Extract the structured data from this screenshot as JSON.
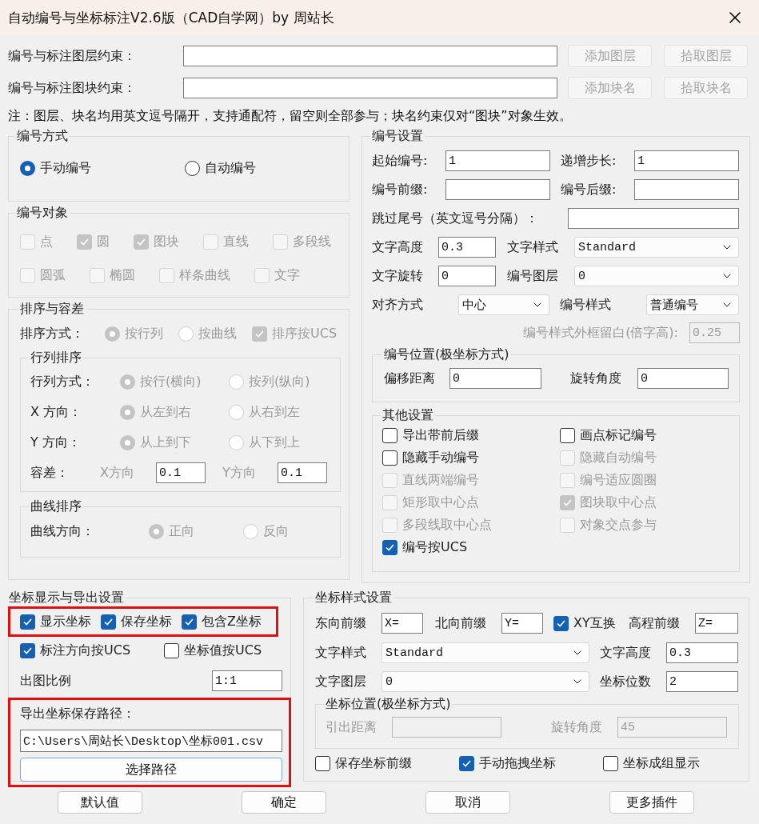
{
  "window": {
    "title": "自动编号与坐标标注V2.6版（CAD自学网）by 周站长"
  },
  "constraints": [
    {
      "label": "编号与标注图层约束：",
      "buttons": [
        {
          "label": "添加图层",
          "disabled": true
        },
        {
          "label": "拾取图层",
          "disabled": true
        }
      ]
    },
    {
      "label": "编号与标注图块约束：",
      "buttons": [
        {
          "label": "添加块名",
          "disabled": true
        },
        {
          "label": "拾取块名",
          "disabled": true
        }
      ]
    }
  ],
  "note": "注：图层、块名均用英文逗号隔开，支持通配符，留空则全部参与；块名约束仅对“图块”对象生效。",
  "numbering_mode": {
    "title": "编号方式",
    "options": [
      {
        "label": "手动编号",
        "selected": true
      },
      {
        "label": "自动编号",
        "selected": false
      }
    ]
  },
  "numbering_objects": {
    "title": "编号对象",
    "items": [
      {
        "label": "点",
        "checked": false,
        "disabled": true
      },
      {
        "label": "圆",
        "checked": true,
        "disabled": true
      },
      {
        "label": "图块",
        "checked": true,
        "disabled": true
      },
      {
        "label": "直线",
        "checked": false,
        "disabled": true
      },
      {
        "label": "多段线",
        "checked": false,
        "disabled": true
      },
      {
        "label": "圆弧",
        "checked": false,
        "disabled": true
      },
      {
        "label": "椭圆",
        "checked": false,
        "disabled": true
      },
      {
        "label": "样条曲线",
        "checked": false,
        "disabled": true
      },
      {
        "label": "文字",
        "checked": false,
        "disabled": true
      }
    ]
  },
  "sorting": {
    "title": "排序与容差",
    "method_label": "排序方式：",
    "methods": [
      {
        "label": "按行列",
        "selected": true,
        "disabled": true
      },
      {
        "label": "按曲线",
        "selected": false,
        "disabled": true
      }
    ],
    "ucs": {
      "label": "排序按UCS",
      "checked": true,
      "disabled": true
    },
    "row_col": {
      "title": "行列排序",
      "rows": [
        {
          "label": "行列方式：",
          "options": [
            {
              "label": "按行(横向)",
              "selected": true,
              "disabled": true
            },
            {
              "label": "按列(纵向)",
              "selected": false,
              "disabled": true
            }
          ]
        },
        {
          "label": "X 方向：",
          "options": [
            {
              "label": "从左到右",
              "selected": true,
              "disabled": true
            },
            {
              "label": "从右到左",
              "selected": false,
              "disabled": true
            }
          ]
        },
        {
          "label": "Y 方向：",
          "options": [
            {
              "label": "从上到下",
              "selected": true,
              "disabled": true
            },
            {
              "label": "从下到上",
              "selected": false,
              "disabled": true
            }
          ]
        }
      ],
      "tolerance": {
        "label": "容差：",
        "x_label": "X方向",
        "x_value": "0.1",
        "y_label": "Y方向",
        "y_value": "0.1",
        "disabled": true
      }
    },
    "curve": {
      "title": "曲线排序",
      "label": "曲线方向：",
      "options": [
        {
          "label": "正向",
          "selected": true,
          "disabled": true
        },
        {
          "label": "反向",
          "selected": false,
          "disabled": true
        }
      ]
    }
  },
  "numbering_settings": {
    "title": "编号设置",
    "start": {
      "label": "起始编号:",
      "value": "1"
    },
    "step": {
      "label": "递增步长:",
      "value": "1"
    },
    "prefix": {
      "label": "编号前缀:"
    },
    "suffix": {
      "label": "编号后缀:"
    },
    "skip": {
      "label": "跳过尾号（英文逗号分隔）："
    },
    "text_height": {
      "label": "文字高度",
      "value": "0.3"
    },
    "text_style": {
      "label": "文字样式",
      "value": "Standard"
    },
    "text_rotation": {
      "label": "文字旋转",
      "value": "0"
    },
    "layer": {
      "label": "编号图层",
      "value": "0"
    },
    "align": {
      "label": "对齐方式",
      "value": "中心"
    },
    "number_style": {
      "label": "编号样式",
      "value": "普通编号"
    },
    "frame_margin": {
      "label": "编号样式外框留白(倍字高):",
      "value": "0.25",
      "disabled": true
    },
    "position": {
      "title": "编号位置(极坐标方式)",
      "offset": {
        "label": "偏移距离",
        "value": "0"
      },
      "angle": {
        "label": "旋转角度",
        "value": "0"
      }
    },
    "other": {
      "title": "其他设置",
      "options": [
        {
          "label": "导出带前后缀",
          "checked": false,
          "disabled": false
        },
        {
          "label": "画点标记编号",
          "checked": false,
          "disabled": false
        },
        {
          "label": "隐藏手动编号",
          "checked": false,
          "disabled": false
        },
        {
          "label": "隐藏自动编号",
          "checked": false,
          "disabled": true
        },
        {
          "label": "直线两端编号",
          "checked": false,
          "disabled": true
        },
        {
          "label": "编号适应圆圈",
          "checked": false,
          "disabled": true
        },
        {
          "label": "矩形取中心点",
          "checked": false,
          "disabled": true
        },
        {
          "label": "图块取中心点",
          "checked": true,
          "disabled": true
        },
        {
          "label": "多段线取中心点",
          "checked": false,
          "disabled": true
        },
        {
          "label": "对象交点参与",
          "checked": false,
          "disabled": true
        },
        {
          "label": "编号按UCS",
          "checked": true,
          "disabled": false
        }
      ]
    }
  },
  "coord_display": {
    "title": "坐标显示与导出设置",
    "main_options": {
      "highlighted": true,
      "items": [
        {
          "label": "显示坐标",
          "checked": true
        },
        {
          "label": "保存坐标",
          "checked": true
        },
        {
          "label": "包含Z坐标",
          "checked": true
        }
      ]
    },
    "ucs_options": [
      {
        "label": "标注方向按UCS",
        "checked": true
      },
      {
        "label": "坐标值按UCS",
        "checked": false
      }
    ],
    "scale": {
      "label": "出图比例",
      "value": "1:1"
    },
    "export": {
      "highlighted": true,
      "label": "导出坐标保存路径：",
      "value": "C:\\Users\\周站长\\Desktop\\坐标001.csv",
      "button": "选择路径"
    }
  },
  "coord_style": {
    "title": "坐标样式设置",
    "east": {
      "label": "东向前缀",
      "value": "X="
    },
    "north": {
      "label": "北向前缀",
      "value": "Y="
    },
    "swap": {
      "label": "XY互换",
      "checked": true
    },
    "elevation": {
      "label": "高程前缀",
      "value": "Z="
    },
    "text_style": {
      "label": "文字样式",
      "value": "Standard"
    },
    "text_height": {
      "label": "文字高度",
      "value": "0.3"
    },
    "text_layer": {
      "label": "文字图层",
      "value": "0"
    },
    "digits": {
      "label": "坐标位数",
      "value": "2"
    },
    "position": {
      "title": "坐标位置(极坐标方式)",
      "lead": {
        "label": "引出距离",
        "disabled": true
      },
      "angle": {
        "label": "旋转角度",
        "value": "45",
        "disabled": true
      }
    },
    "options": [
      {
        "label": "保存坐标前缀",
        "checked": false
      },
      {
        "label": "手动拖拽坐标",
        "checked": true
      },
      {
        "label": "坐标成组显示",
        "checked": false
      }
    ]
  },
  "buttons": [
    "默认值",
    "确定",
    "取消",
    "更多插件"
  ]
}
